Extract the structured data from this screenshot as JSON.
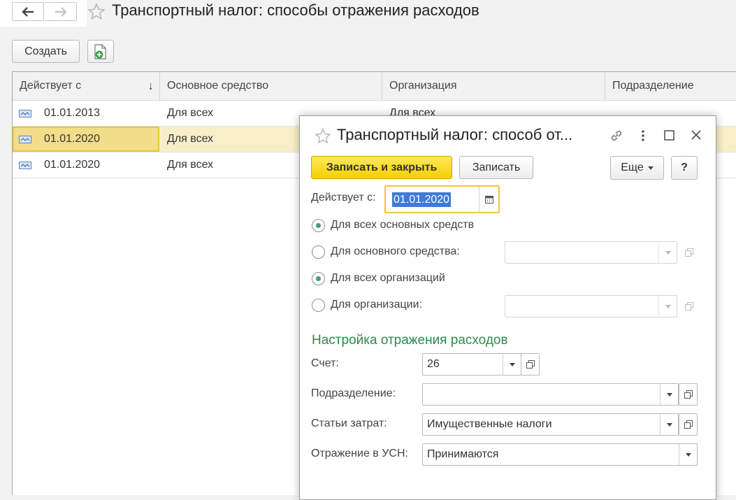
{
  "main": {
    "title": "Транспортный налог: способы отражения расходов",
    "create_label": "Создать",
    "columns": [
      "Действует с",
      "Основное средство",
      "Организация",
      "Подразделение"
    ],
    "rows": [
      {
        "date": "01.01.2013",
        "asset": "Для всех",
        "org": "Для всех"
      },
      {
        "date": "01.01.2020",
        "asset": "Для всех"
      },
      {
        "date": "01.01.2020",
        "asset": "Для всех"
      }
    ]
  },
  "dialog": {
    "title": "Транспортный налог: способ от...",
    "save_close_label": "Записать и закрыть",
    "save_label": "Записать",
    "more_label": "Еще",
    "help_label": "?",
    "date_label": "Действует с:",
    "date_value": "01.01.2020",
    "radio_all_assets": "Для всех основных средств",
    "radio_asset": "Для основного средства:",
    "radio_all_orgs": "Для всех организаций",
    "radio_org": "Для организации:",
    "section_title": "Настройка отражения расходов",
    "account_label": "Счет:",
    "account_value": "26",
    "division_label": "Подразделение:",
    "division_value": "",
    "cost_label": "Статьи затрат:",
    "cost_value": "Имущественные налоги",
    "usn_label": "Отражение в УСН:",
    "usn_value": "Принимаются"
  },
  "colors": {
    "accent_yellow": "#f5cf00",
    "selection_row": "#f8efc9",
    "section_green": "#2e8a4c",
    "radio_green": "#3ba36b"
  }
}
